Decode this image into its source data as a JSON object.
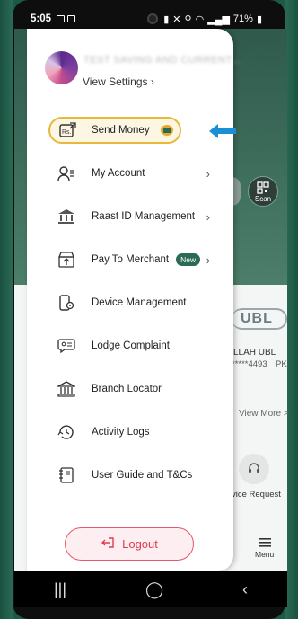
{
  "status_bar": {
    "time": "5:05",
    "battery": "71%"
  },
  "background": {
    "scan_label": "Scan",
    "bank_logo": "UBL",
    "account_name": "LLAH UBL",
    "account_number": "*****4493",
    "account_extra": "PK",
    "view_more": "View More >",
    "service_label": "vice Request",
    "menu_label": "Menu"
  },
  "drawer": {
    "profile_name": "TEST SAVING AND CURRENT...",
    "view_settings": "View Settings",
    "items": [
      {
        "label": "Send Money",
        "icon": "rupee-send-icon"
      },
      {
        "label": "My Account",
        "icon": "user-list-icon"
      },
      {
        "label": "Raast ID Management",
        "icon": "bank-id-icon"
      },
      {
        "label": "Pay To Merchant",
        "icon": "merchant-pay-icon",
        "badge": "New"
      },
      {
        "label": "Device Management",
        "icon": "device-gear-icon"
      },
      {
        "label": "Lodge Complaint",
        "icon": "complaint-chat-icon"
      },
      {
        "label": "Branch Locator",
        "icon": "bank-building-icon"
      },
      {
        "label": "Activity Logs",
        "icon": "clock-history-icon"
      },
      {
        "label": "User Guide and T&Cs",
        "icon": "guide-book-icon"
      }
    ],
    "logout_label": "Logout"
  },
  "colors": {
    "highlight": "#e7b83b",
    "arrow": "#1a8fd6",
    "brand_green": "#2b6a55",
    "logout": "#e03a4e"
  }
}
